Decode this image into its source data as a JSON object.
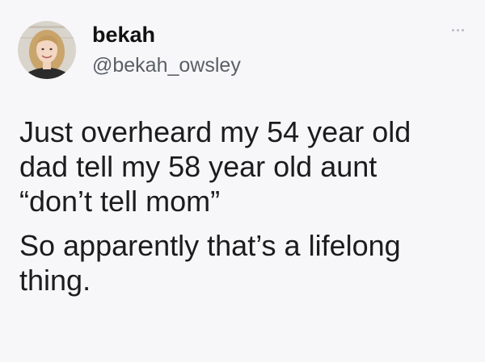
{
  "tweet": {
    "display_name": "bekah",
    "handle": "@bekah_owsley",
    "more_icon": "more-options-icon",
    "paragraphs": [
      "Just overheard my 54 year old\ndad tell my 58 year old aunt\n“don’t tell mom”",
      "So apparently that’s a lifelong\nthing."
    ]
  },
  "colors": {
    "background": "#f7f7f9",
    "text": "#1c1c1e",
    "handle": "#5a5f66"
  }
}
